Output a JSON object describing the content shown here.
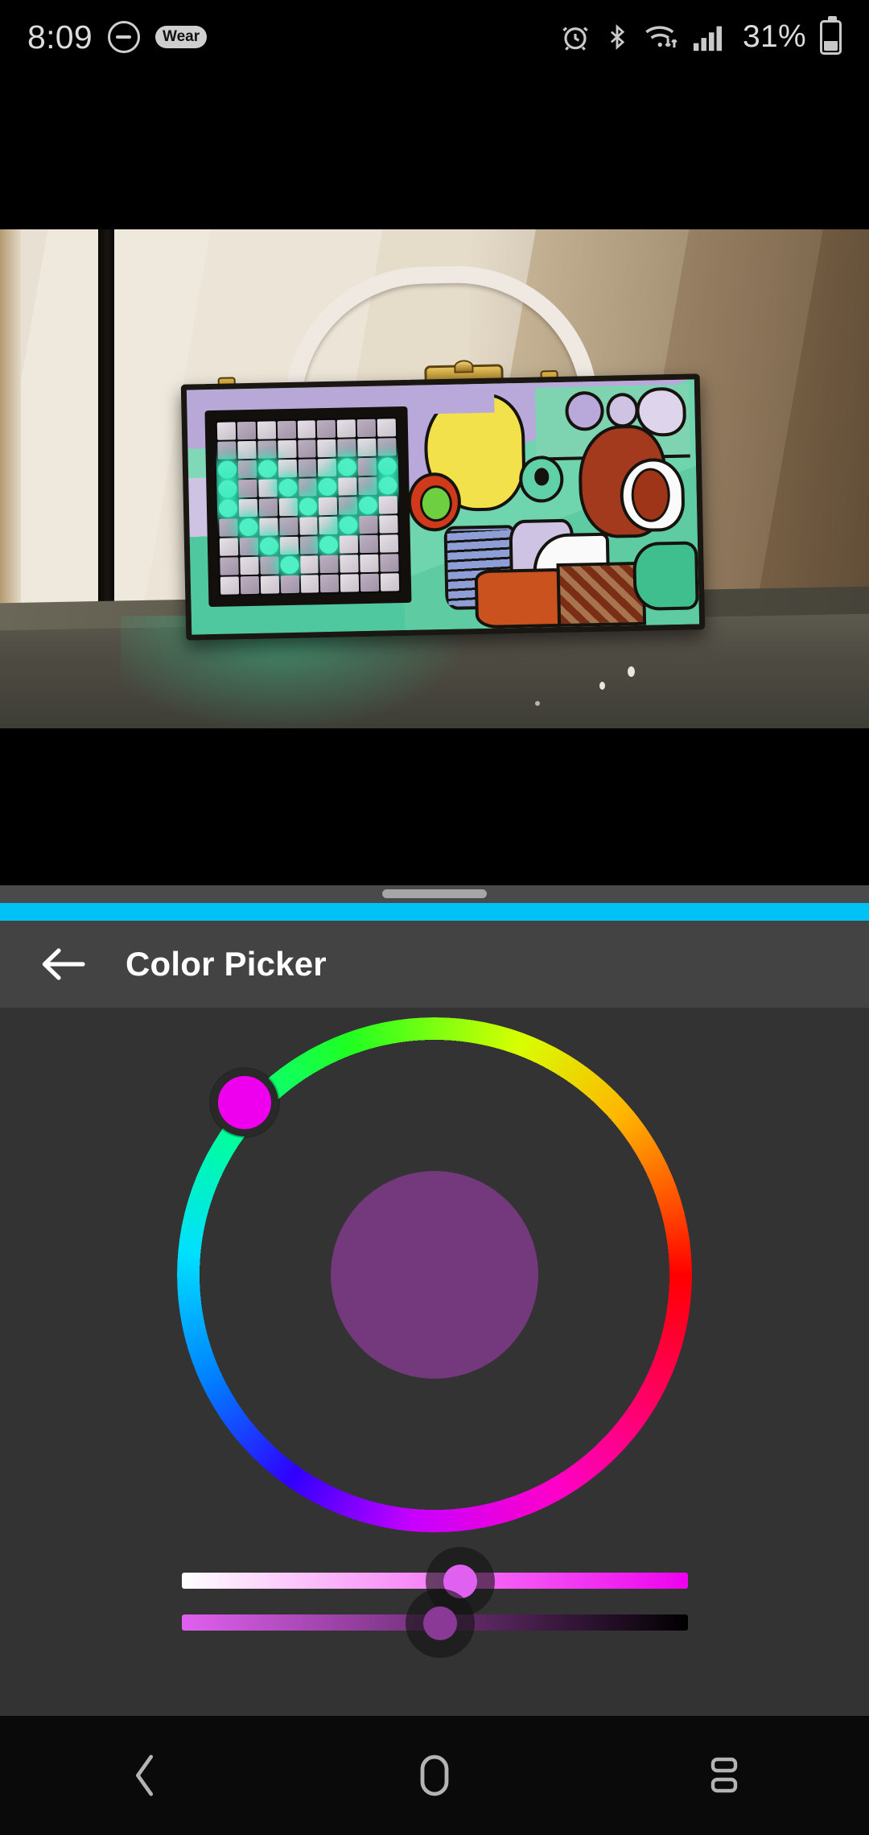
{
  "status_bar": {
    "time": "8:09",
    "dnd_icon": "do-not-disturb-icon",
    "wear_badge": "Wear",
    "alarm_icon": "alarm-clock-icon",
    "bluetooth_icon": "bluetooth-icon",
    "wifi_icon": "wifi-icon",
    "signal_icon": "cellular-signal-icon",
    "battery_percent": "31%",
    "battery_icon": "battery-icon"
  },
  "photo": {
    "description": "Hand-painted Picasso-style handbag with LED matrix panel on a shelf",
    "led_color": "#4ff0c4",
    "wall_color": "#ece4d6",
    "shelf_color": "#4e4c42"
  },
  "sheet": {
    "handle_color": "#a6a6a6",
    "accent_color": "#00c2f5"
  },
  "header": {
    "back_icon": "arrow-left-icon",
    "title": "Color Picker",
    "background": "#434343"
  },
  "picker": {
    "background": "#333333",
    "preview_color": "#73397C",
    "hue_thumb_color": "#ee00ee",
    "hue_angle_deg": 312,
    "hue_value": 312,
    "ring_colors": [
      "#ff0000",
      "#ff00c8",
      "#c800ff",
      "#3000ff",
      "#0080ff",
      "#00e0ff",
      "#00ff9a",
      "#20ff20",
      "#d8ff00",
      "#ffb400",
      "#ff4800"
    ],
    "sliders": [
      {
        "name": "saturation",
        "position_pct": 55,
        "track_from": "#ffffff",
        "track_to": "#ee00ee",
        "thumb_color": "#e060f0"
      },
      {
        "name": "value",
        "position_pct": 51,
        "track_from": "#e060f0",
        "track_to": "#000000",
        "thumb_color": "#8a3a96"
      }
    ]
  },
  "nav_bar": {
    "back_label": "back-icon",
    "home_label": "home-icon",
    "recents_label": "recents-icon",
    "background": "#0a0a0a"
  }
}
